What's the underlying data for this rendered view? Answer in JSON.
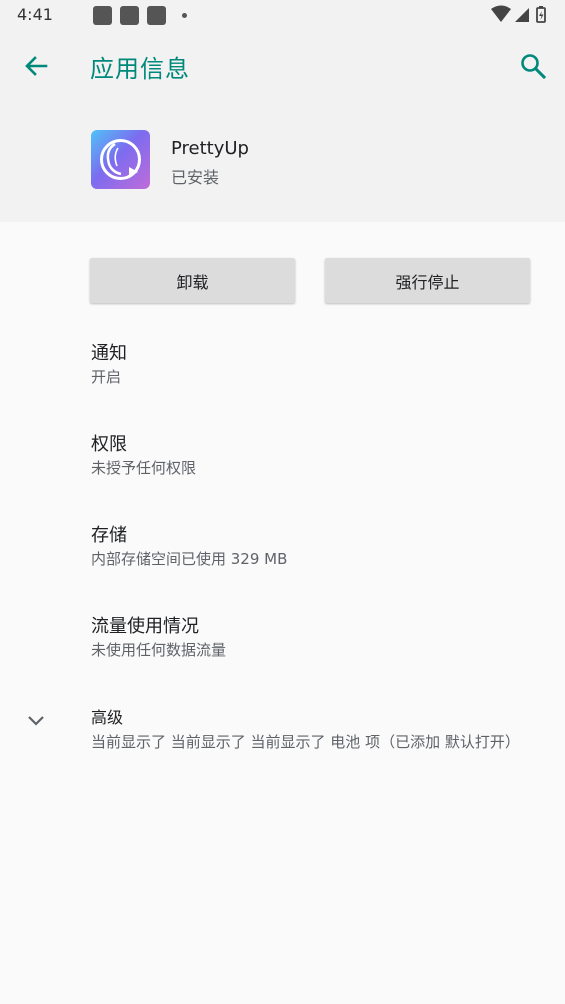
{
  "status_bar": {
    "time": "4:41"
  },
  "header": {
    "title": "应用信息",
    "back_icon": "arrow-left-icon",
    "search_icon": "search-icon"
  },
  "app": {
    "name": "PrettyUp",
    "status": "已安装",
    "icon": "prettyup-app-icon"
  },
  "buttons": {
    "uninstall": "卸载",
    "force_stop": "强行停止"
  },
  "items": [
    {
      "title": "通知",
      "subtitle": "开启"
    },
    {
      "title": "权限",
      "subtitle": "未授予任何权限"
    },
    {
      "title": "存储",
      "subtitle": "内部存储空间已使用 329 MB"
    },
    {
      "title": "流量使用情况",
      "subtitle": "未使用任何数据流量"
    },
    {
      "title": "高级",
      "subtitle": "当前显示了 当前显示了 当前显示了 电池 项（已添加 默认打开）"
    }
  ],
  "colors": {
    "accent": "#00897b",
    "background": "#fafafa",
    "header_bg": "#f2f2f2",
    "button_bg": "#dcdcdc"
  }
}
